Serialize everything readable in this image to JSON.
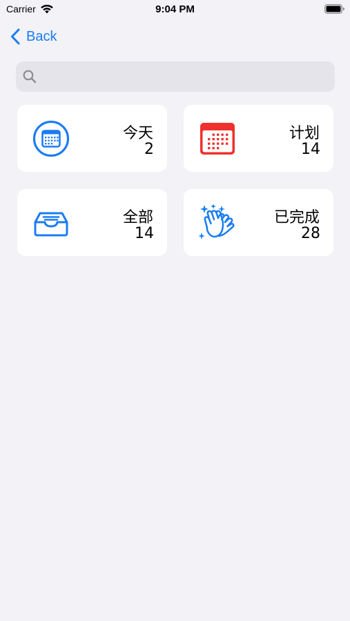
{
  "status_bar": {
    "carrier": "Carrier",
    "time": "9:04 PM"
  },
  "nav": {
    "back_label": "Back"
  },
  "search": {
    "placeholder": "",
    "value": ""
  },
  "lists": [
    {
      "label": "今天",
      "count": "2",
      "icon": "calendar-circle-icon",
      "color": "#1a7cf2"
    },
    {
      "label": "计划",
      "count": "14",
      "icon": "calendar-icon",
      "color": "#f0302e"
    },
    {
      "label": "全部",
      "count": "14",
      "icon": "tray-icon",
      "color": "#1a7cf2"
    },
    {
      "label": "已完成",
      "count": "28",
      "icon": "clapping-hands-icon",
      "color": "#1a7cf2"
    }
  ],
  "colors": {
    "accent": "#1a7cf2",
    "background": "#f2f2f7",
    "search_bg": "#e4e4ea"
  }
}
